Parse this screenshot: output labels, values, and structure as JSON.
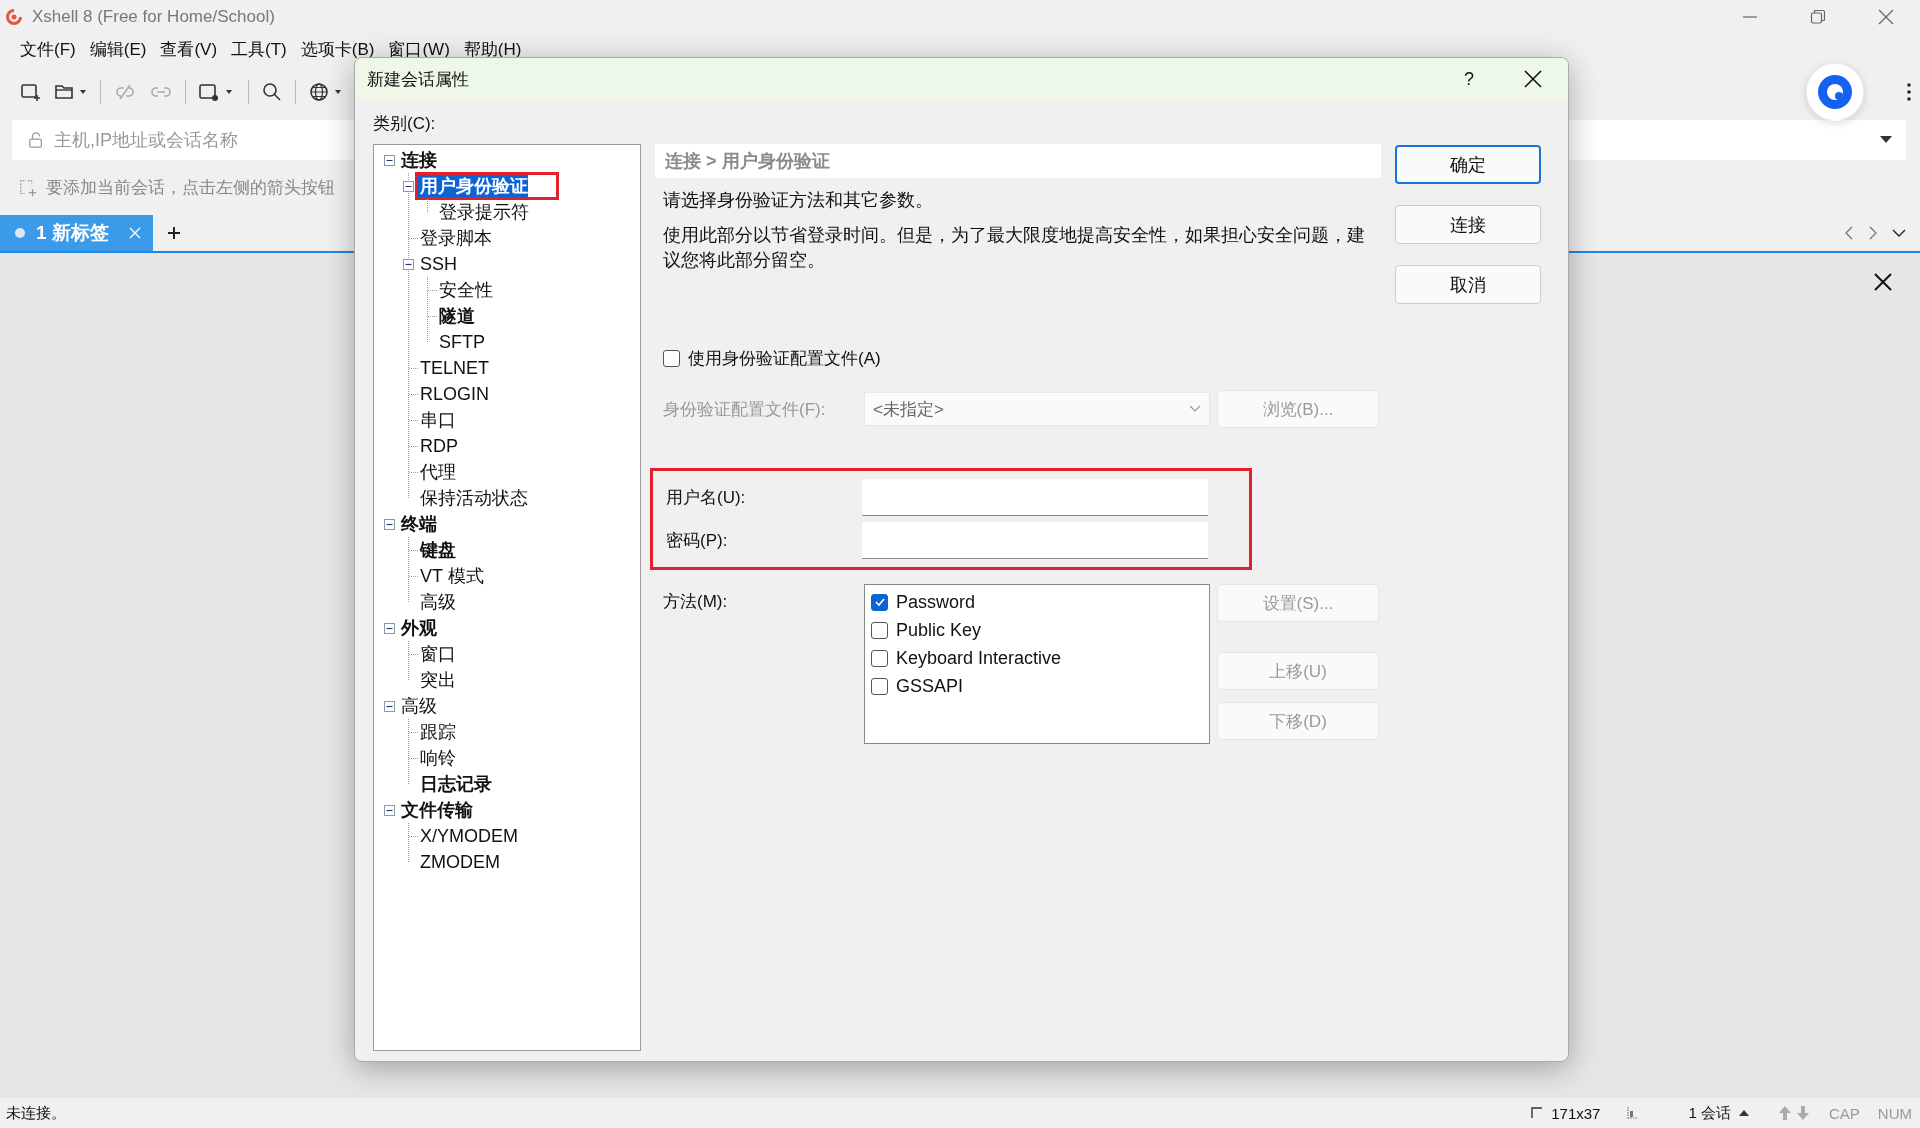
{
  "app": {
    "title": "Xshell 8 (Free for Home/School)"
  },
  "menu": [
    "文件(F)",
    "编辑(E)",
    "查看(V)",
    "工具(T)",
    "选项卡(B)",
    "窗口(W)",
    "帮助(H)"
  ],
  "address_bar": {
    "placeholder": "主机,IP地址或会话名称"
  },
  "hint": "要添加当前会话，点击左侧的箭头按钮",
  "tabs": [
    {
      "label": "1 新标签",
      "selected": true
    }
  ],
  "dialog": {
    "title": "新建会话属性",
    "help": "?",
    "category_label": "类别(C):",
    "tree": [
      {
        "label": "连接",
        "bold": true,
        "selected": false,
        "annotated": false,
        "expanded": true,
        "children": [
          {
            "label": "用户身份验证",
            "bold": true,
            "selected": true,
            "annotated": true,
            "expanded": true,
            "children": [
              {
                "label": "登录提示符",
                "bold": false,
                "selected": false,
                "annotated": false
              }
            ]
          },
          {
            "label": "登录脚本",
            "bold": false,
            "selected": false,
            "annotated": false
          },
          {
            "label": "SSH",
            "bold": false,
            "selected": false,
            "annotated": false,
            "expanded": true,
            "children": [
              {
                "label": "安全性",
                "bold": false,
                "selected": false,
                "annotated": false
              },
              {
                "label": "隧道",
                "bold": true,
                "selected": false,
                "annotated": false
              },
              {
                "label": "SFTP",
                "bold": false,
                "selected": false,
                "annotated": false
              }
            ]
          },
          {
            "label": "TELNET",
            "bold": false,
            "selected": false,
            "annotated": false
          },
          {
            "label": "RLOGIN",
            "bold": false,
            "selected": false,
            "annotated": false
          },
          {
            "label": "串口",
            "bold": false,
            "selected": false,
            "annotated": false
          },
          {
            "label": "RDP",
            "bold": false,
            "selected": false,
            "annotated": false
          },
          {
            "label": "代理",
            "bold": false,
            "selected": false,
            "annotated": false
          },
          {
            "label": "保持活动状态",
            "bold": false,
            "selected": false,
            "annotated": false
          }
        ]
      },
      {
        "label": "终端",
        "bold": true,
        "selected": false,
        "annotated": false,
        "expanded": true,
        "children": [
          {
            "label": "键盘",
            "bold": true,
            "selected": false,
            "annotated": false
          },
          {
            "label": "VT 模式",
            "bold": false,
            "selected": false,
            "annotated": false
          },
          {
            "label": "高级",
            "bold": false,
            "selected": false,
            "annotated": false
          }
        ]
      },
      {
        "label": "外观",
        "bold": true,
        "selected": false,
        "annotated": false,
        "expanded": true,
        "children": [
          {
            "label": "窗口",
            "bold": false,
            "selected": false,
            "annotated": false
          },
          {
            "label": "突出",
            "bold": false,
            "selected": false,
            "annotated": false
          }
        ]
      },
      {
        "label": "高级",
        "bold": false,
        "selected": false,
        "annotated": false,
        "expanded": true,
        "children": [
          {
            "label": "跟踪",
            "bold": false,
            "selected": false,
            "annotated": false
          },
          {
            "label": "响铃",
            "bold": false,
            "selected": false,
            "annotated": false
          },
          {
            "label": "日志记录",
            "bold": true,
            "selected": false,
            "annotated": false
          }
        ]
      },
      {
        "label": "文件传输",
        "bold": true,
        "selected": false,
        "annotated": false,
        "expanded": true,
        "children": [
          {
            "label": "X/YMODEM",
            "bold": false,
            "selected": false,
            "annotated": false
          },
          {
            "label": "ZMODEM",
            "bold": false,
            "selected": false,
            "annotated": false
          }
        ]
      }
    ],
    "breadcrumb": "连接 > 用户身份验证",
    "description": [
      "请选择身份验证方法和其它参数。",
      "使用此部分以节省登录时间。但是，为了最大限度地提高安全性，如果担心安全问题，建议您将此部分留空。"
    ],
    "use_profile": {
      "label": "使用身份验证配置文件(A)",
      "checked": false
    },
    "profile": {
      "label": "身份验证配置文件(F):",
      "value": "<未指定>",
      "disabled": true,
      "browse": "浏览(B)..."
    },
    "credentials": {
      "annotated": true,
      "fields": [
        {
          "label": "用户名(U):"
        },
        {
          "label": "密码(P):"
        }
      ]
    },
    "method": {
      "label": "方法(M):",
      "options": [
        {
          "label": "Password",
          "checked": true
        },
        {
          "label": "Public Key",
          "checked": false
        },
        {
          "label": "Keyboard Interactive",
          "checked": false
        },
        {
          "label": "GSSAPI",
          "checked": false
        }
      ]
    },
    "side_buttons": [
      {
        "label": "设置(S)...",
        "disabled": true
      },
      {
        "label": "上移(U)",
        "disabled": true
      },
      {
        "label": "下移(D)",
        "disabled": true
      }
    ],
    "buttons": [
      {
        "label": "确定",
        "default": true
      },
      {
        "label": "连接",
        "default": false
      },
      {
        "label": "取消",
        "default": false
      }
    ]
  },
  "status_bar": {
    "text": "未连接。",
    "size": "171x37",
    "sessions": "1 会话",
    "cap": "CAP",
    "num": "NUM"
  }
}
